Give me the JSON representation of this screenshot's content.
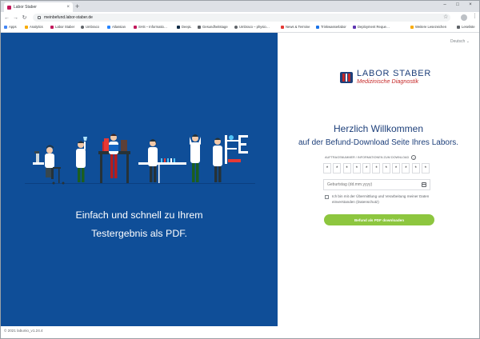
{
  "browser": {
    "tab_title": "Labor Staber",
    "tab_close": "×",
    "new_tab": "+",
    "minimize": "–",
    "maximize": "□",
    "close": "×",
    "url": "meinbefund.labor-staber.de",
    "back": "←",
    "forward": "→",
    "reload": "↻",
    "star": "☆",
    "menu": "⋮"
  },
  "bookmarks": {
    "items": [
      {
        "label": "Apps",
        "color": "#4285f4"
      },
      {
        "label": "Analytics",
        "color": "#f9ab00"
      },
      {
        "label": "Labor Staber",
        "color": "#c2185b"
      },
      {
        "label": "Umbraco",
        "color": "#5f6368"
      },
      {
        "label": "Atlassian",
        "color": "#2684ff"
      },
      {
        "label": "SHS – Informatio…",
        "color": "#c2185b"
      },
      {
        "label": "DeepL",
        "color": "#0f2b46"
      },
      {
        "label": "Gesundheitstage",
        "color": "#5f6368"
      },
      {
        "label": "Umbraco – physio…",
        "color": "#5f6368"
      },
      {
        "label": "News & Termine",
        "color": "#e53935"
      },
      {
        "label": "Trinkwasserlabor",
        "color": "#1a73e8"
      },
      {
        "label": "Deployment Reque…",
        "color": "#5e35b1"
      }
    ],
    "folder": "Weitere Lesezeichen",
    "reading_list": "Leseliste"
  },
  "hero": {
    "line1": "Einfach und schnell zu Ihrem",
    "line2": "Testergebnis als PDF."
  },
  "footer": "© 2021 labunio_v1.24.4",
  "language": "Deutsch ⌄",
  "logo": {
    "name": "LABOR STABER",
    "sub": "Medizinische Diagnostik"
  },
  "welcome": "Herzlich Willkommen",
  "subline": "auf der Befund-Download Seite Ihres Labors.",
  "form": {
    "code_label": "AUFTRAGSNUMMER / INFORMATIONEN ZUM DOWNLOAD",
    "info": "i",
    "code_chars": [
      "*",
      "*",
      "*",
      "*",
      "*",
      "*",
      "*",
      "*",
      "*",
      "*",
      "*"
    ],
    "dob_placeholder": "Geburtstag (dd.mm.yyyy)",
    "consent_text": "Ich bin mit der Übermittlung und Verarbeitung meiner Daten einverstanden",
    "consent_link": "(Datenschutz)",
    "button": "Befund als PDF downloaden"
  },
  "colors": {
    "hero_bg": "#0f4e98",
    "brand_blue": "#1d3f7a",
    "brand_red": "#c62828",
    "button_green": "#8dc63f"
  }
}
